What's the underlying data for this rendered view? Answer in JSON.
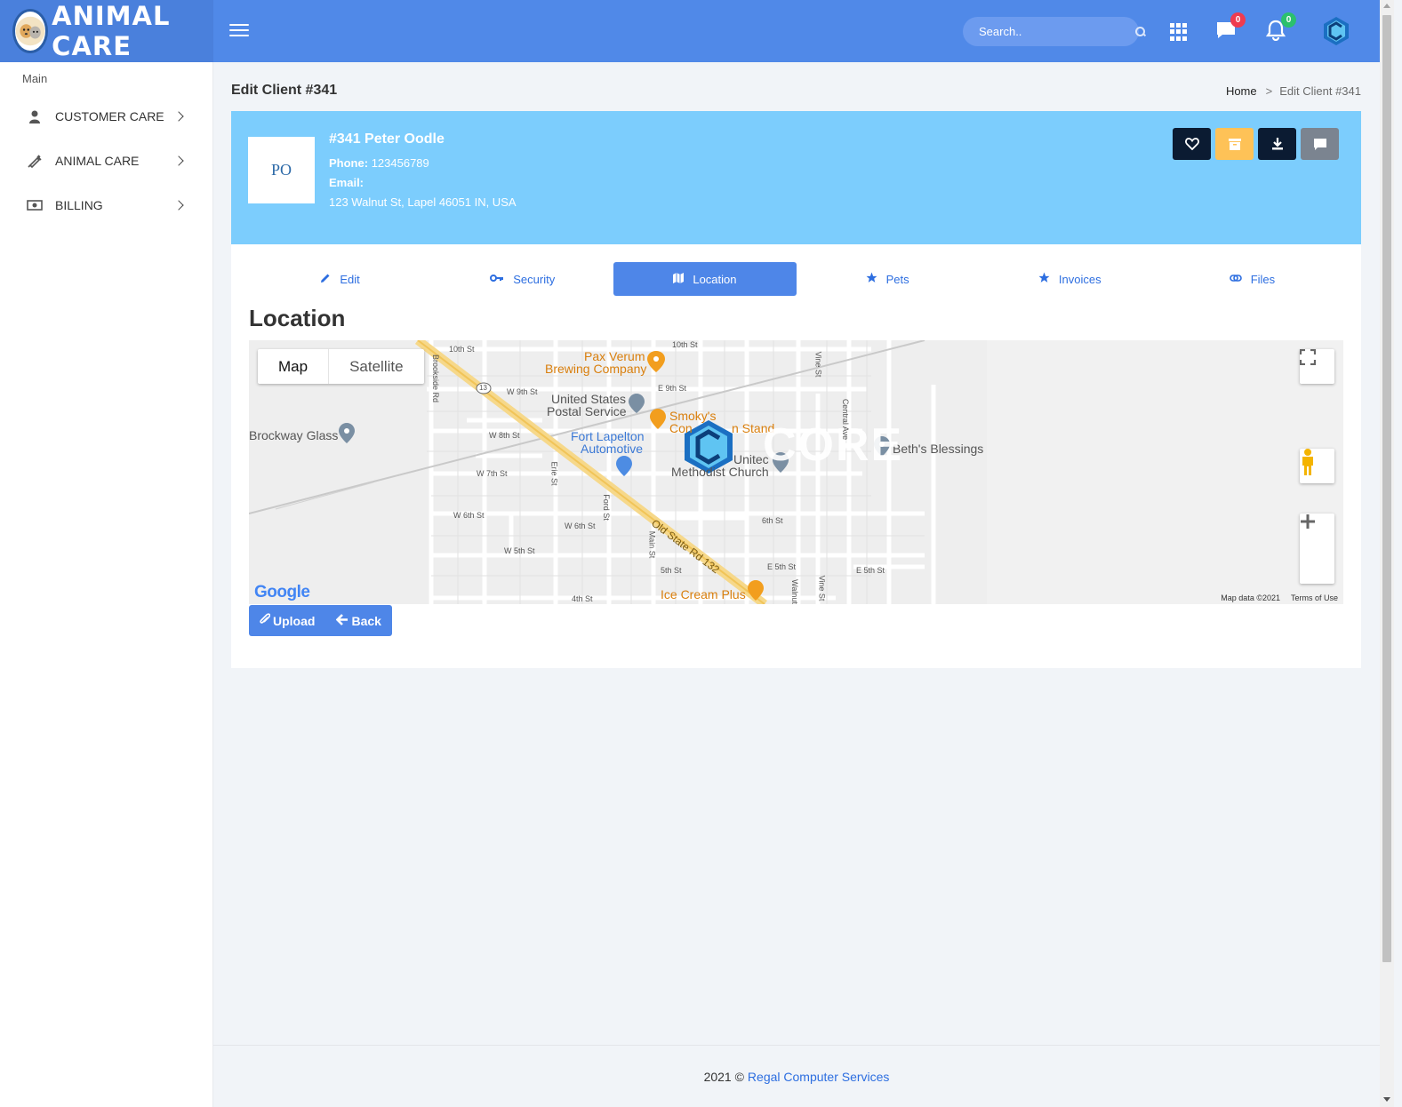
{
  "header": {
    "brand_name": "ANIMAL CARE",
    "search_placeholder": "Search..",
    "messages_count": "0",
    "notifications_count": "0"
  },
  "sidebar": {
    "section_title": "Main",
    "items": [
      {
        "label": "CUSTOMER CARE",
        "icon": "user-icon"
      },
      {
        "label": "ANIMAL CARE",
        "icon": "syringe-icon"
      },
      {
        "label": "BILLING",
        "icon": "money-icon"
      }
    ]
  },
  "page": {
    "title": "Edit Client #341",
    "breadcrumb_home": "Home",
    "breadcrumb_current": "Edit Client #341"
  },
  "client": {
    "initials": "PO",
    "name": "#341 Peter Oodle",
    "phone_label": "Phone:",
    "phone": "123456789",
    "email_label": "Email:",
    "email": "",
    "address": "123 Walnut St, Lapel 46051 IN, USA"
  },
  "tabs": [
    {
      "label": "Edit",
      "icon": "pencil-icon",
      "active": false
    },
    {
      "label": "Security",
      "icon": "key-icon",
      "active": false
    },
    {
      "label": "Location",
      "icon": "map-icon",
      "active": true
    },
    {
      "label": "Pets",
      "icon": "star-icon",
      "active": false
    },
    {
      "label": "Invoices",
      "icon": "star-icon",
      "active": false
    },
    {
      "label": "Files",
      "icon": "link-icon",
      "active": false
    }
  ],
  "section_title": "Location",
  "map": {
    "type_map": "Map",
    "type_satellite": "Satellite",
    "google": "Google",
    "attribution": "Map data ©2021",
    "terms": "Terms of Use",
    "places": {
      "pax_verum_1": "Pax Verum",
      "pax_verum_2": "Brewing Company",
      "usps_1": "United States",
      "usps_2": "Postal Service",
      "brockway": "Brockway Glass",
      "smokys_1": "Smoky's",
      "smokys_2": "Con",
      "smokys_3": "n Stand",
      "fort_1": "Fort Lapelton",
      "fort_2": "Automotive",
      "umc_1": "Unitec",
      "umc_2": "Methodist Church",
      "beths": "Beth's Blessings",
      "icecream": "Ice Cream Plus",
      "core": "CORE"
    },
    "streets": {
      "s10th_a": "10th St",
      "s10th_b": "10th St",
      "w9th": "W 9th St",
      "e9th": "E 9th St",
      "w8th": "W 8th St",
      "w7th": "W 7th St",
      "w6th_a": "W 6th St",
      "w6th_b": "W 6th St",
      "s6th": "6th St",
      "w5th": "W 5th St",
      "s5th": "5th St",
      "e5th_a": "E 5th St",
      "e5th_b": "E 5th St",
      "s4th": "4th St",
      "brookside": "Brookside Rd",
      "erie": "Erie St",
      "ford": "Ford St",
      "main": "Main St",
      "vine_a": "Vine St",
      "vine_b": "Vine St",
      "central": "Central Ave",
      "walnut": "Walnut",
      "oldstate": "Old State Rd 132",
      "route": "13"
    }
  },
  "buttons": {
    "upload": "Upload",
    "back": "Back"
  },
  "footer": {
    "copyright": "2021 ©",
    "company": "Regal Computer Services"
  },
  "colors": {
    "header": "#5089e8",
    "brand_bg": "#4a80dc",
    "client_card": "#7ccdfd",
    "active_tab": "#4e86e8",
    "accent_blue": "#2d6ee0"
  }
}
